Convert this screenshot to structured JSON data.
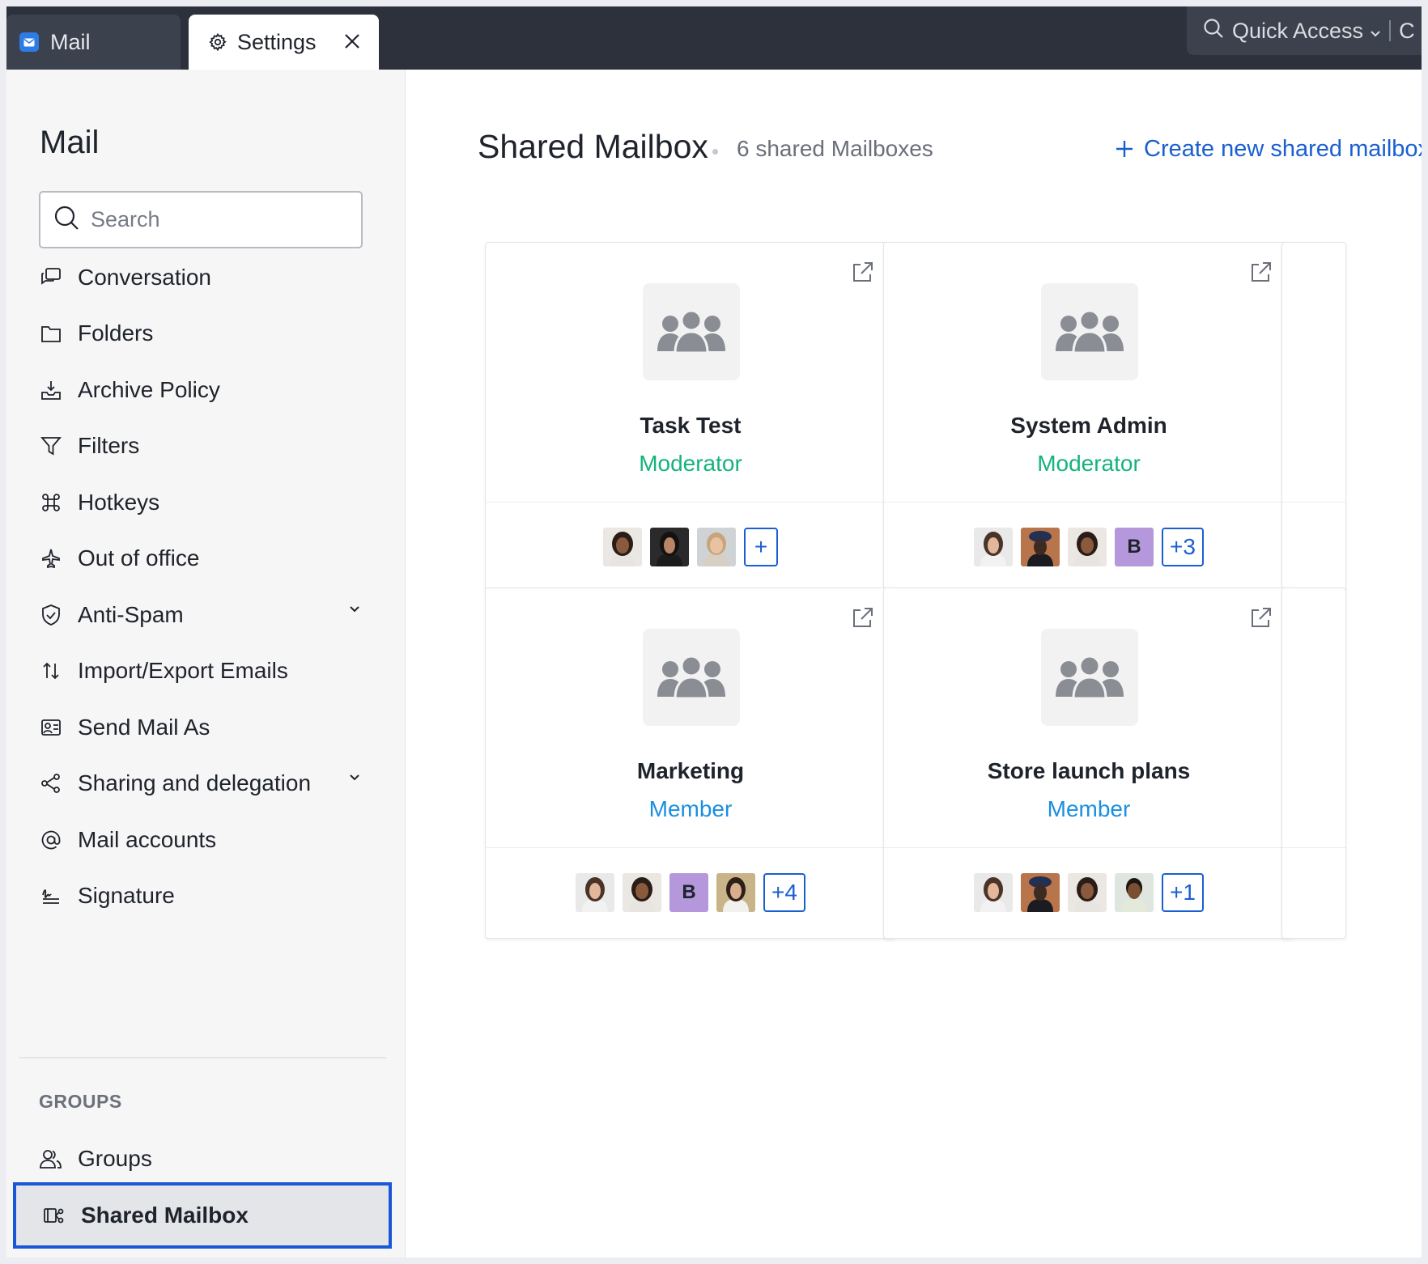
{
  "tabs": {
    "mail": "Mail",
    "settings": "Settings"
  },
  "quick_access": {
    "label": "Quick Access",
    "more": "C"
  },
  "sidebar": {
    "title": "Mail",
    "search_placeholder": "Search",
    "items": [
      {
        "label": "Conversation",
        "icon": "conversation-icon"
      },
      {
        "label": "Folders",
        "icon": "folder-icon"
      },
      {
        "label": "Archive Policy",
        "icon": "archive-icon"
      },
      {
        "label": "Filters",
        "icon": "filter-icon"
      },
      {
        "label": "Hotkeys",
        "icon": "command-icon"
      },
      {
        "label": "Out of office",
        "icon": "plane-icon"
      },
      {
        "label": "Anti-Spam",
        "icon": "shield-icon",
        "expandable": true
      },
      {
        "label": "Import/Export Emails",
        "icon": "import-export-icon"
      },
      {
        "label": "Send Mail As",
        "icon": "send-as-icon"
      },
      {
        "label": "Sharing and delegation",
        "icon": "share-icon",
        "expandable": true
      },
      {
        "label": "Mail accounts",
        "icon": "at-icon"
      },
      {
        "label": "Signature",
        "icon": "signature-icon"
      }
    ],
    "groups_heading": "GROUPS",
    "group_items": [
      {
        "label": "Groups",
        "icon": "groups-icon"
      },
      {
        "label": "Shared Mailbox",
        "icon": "shared-mailbox-icon",
        "active": true
      }
    ]
  },
  "main": {
    "title": "Shared Mailbox",
    "count_label": "6 shared Mailboxes",
    "create_label": "Create new shared mailbox",
    "cards": [
      {
        "name": "Task Test",
        "role": "Moderator",
        "more": "+"
      },
      {
        "name": "System Admin",
        "role": "Moderator",
        "avatar_letter": "B",
        "more": "+3"
      },
      {
        "name": "Marketing",
        "role": "Member",
        "avatar_letter": "B",
        "more": "+4"
      },
      {
        "name": "Store launch plans",
        "role": "Member",
        "more": "+1"
      }
    ]
  },
  "colors": {
    "accent": "#1a5fd1",
    "moderator": "#14b47a",
    "member": "#1a8fe0",
    "active_border": "#1a57d6",
    "topbar": "#2c313c"
  }
}
